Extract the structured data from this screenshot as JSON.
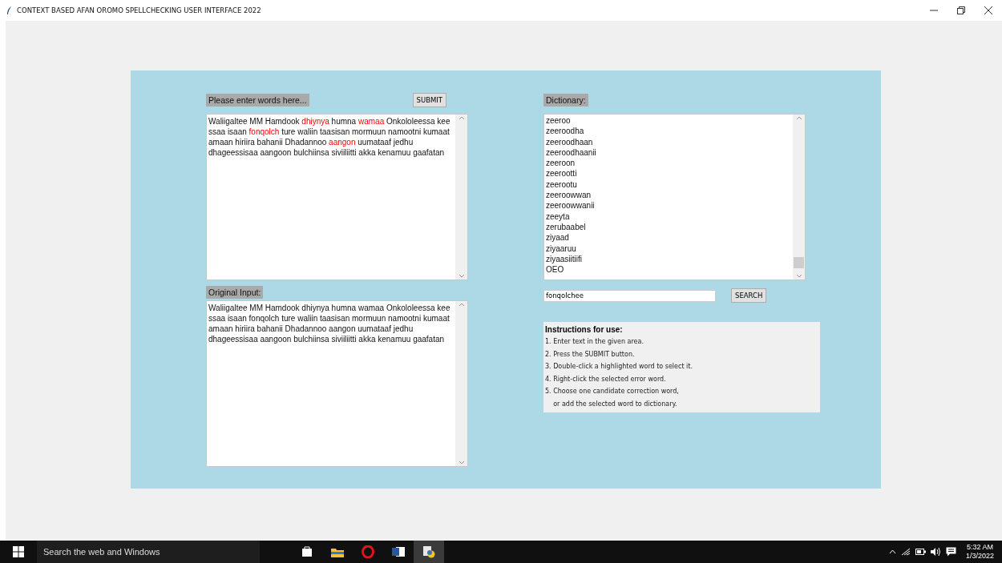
{
  "window": {
    "title": "CONTEXT BASED AFAN OROMO SPELLCHECKING USER INTERFACE 2022"
  },
  "input_panel": {
    "label": "Please enter words here...",
    "submit": "SUBMIT",
    "lines": [
      [
        {
          "text": "Waliigaltee MM Hamdook ",
          "error": false
        },
        {
          "text": "dhiynya",
          "error": true
        },
        {
          "text": " humna ",
          "error": false
        },
        {
          "text": "wamaa",
          "error": true
        },
        {
          "text": " Onkololeessa kee",
          "error": false
        }
      ],
      [
        {
          "text": "ssaa isaan ",
          "error": false
        },
        {
          "text": "fonqolch",
          "error": true
        },
        {
          "text": " ture waliin taasisan mormuun namootni kumaat",
          "error": false
        }
      ],
      [
        {
          "text": "amaan hiriira bahanii Dhadannoo ",
          "error": false
        },
        {
          "text": "aangon",
          "error": true
        },
        {
          "text": " uumataaf jedhu",
          "error": false
        }
      ],
      [
        {
          "text": "dhageessisaa aangoon bulchiinsa siviiliitti akka kenamuu gaafatan",
          "error": false
        }
      ]
    ]
  },
  "original_panel": {
    "label": "Original Input:",
    "lines": [
      "Waliigaltee MM Hamdook dhiynya humna wamaa Onkololeessa kee",
      "ssaa isaan fonqolch ture waliin taasisan mormuun namootni kumaat",
      "amaan hiriira bahanii Dhadannoo aangon uumataaf jedhu",
      "dhageessisaa aangoon bulchiinsa siviiliitti akka kenamuu gaafatan"
    ]
  },
  "dictionary": {
    "label": "Dictionary:",
    "items": [
      "zeeroo",
      "zeeroodha",
      "zeeroodhaan",
      "zeeroodhaanii",
      "zeeroon",
      "zeerootti",
      "zeerootu",
      "zeeroowwan",
      "zeeroowwanii",
      "zeeyta",
      "zerubaabel",
      "ziyaad",
      "ziyaaruu",
      "ziyaasiitiifi",
      "OEO"
    ]
  },
  "search": {
    "value": "fonqolchee",
    "button": "SEARCH"
  },
  "instructions": {
    "title": "Instructions for use:",
    "steps": [
      "1. Enter text in the given area.",
      "2. Press the SUBMIT button.",
      "3. Double-click a highlighted word to select it.",
      "4. Right-click the selected error word.",
      "5. Choose one candidate correction word,",
      "    or add the selected word to dictionary."
    ]
  },
  "taskbar": {
    "search": "Search the web and Windows",
    "time": "5:32 AM",
    "date": "1/3/2022"
  }
}
